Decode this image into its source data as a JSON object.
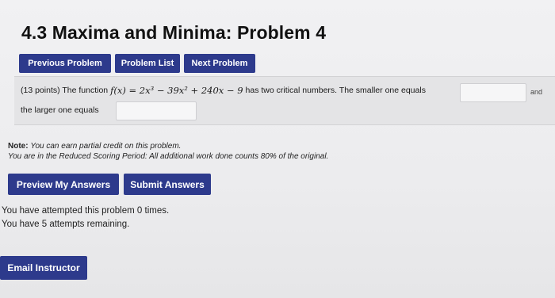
{
  "page": {
    "title": "4.3 Maxima and Minima: Problem 4"
  },
  "nav": {
    "previous_label": "Previous Problem",
    "list_label": "Problem List",
    "next_label": "Next Problem"
  },
  "problem": {
    "points": "(13 points) The function",
    "function_lhs": "f(x) = 2x³ − 39x² + 240x − 9",
    "statement_mid": "has two critical numbers. The smaller one equals",
    "and_label": "and",
    "statement_end": "the larger one equals",
    "smaller_value": "",
    "larger_value": ""
  },
  "note": {
    "label": "Note:",
    "line1": "You can earn partial credit on this problem.",
    "line2": "You are in the Reduced Scoring Period: All additional work done counts 80% of the original."
  },
  "actions": {
    "preview_label": "Preview My Answers",
    "submit_label": "Submit Answers"
  },
  "attempts": {
    "line1": "You have attempted this problem 0 times.",
    "line2": "You have 5 attempts remaining."
  },
  "footer": {
    "email_label": "Email Instructor"
  },
  "colors": {
    "button_bg": "#2d3a8c",
    "page_bg": "#ececee"
  }
}
